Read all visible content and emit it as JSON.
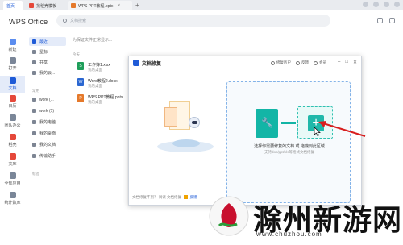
{
  "tabs": [
    {
      "label": "首页",
      "active": true
    },
    {
      "label": "找稻壳模板",
      "active": false
    },
    {
      "label": "WPS PPT教程.pptx",
      "active": false
    }
  ],
  "header": {
    "logo": "WPS Office",
    "search_placeholder": "文档搜索"
  },
  "rail": [
    {
      "label": "新建",
      "icon": "plus-icon",
      "color": "#5b8def"
    },
    {
      "label": "打开",
      "icon": "folder-icon",
      "color": "#7a8698"
    },
    {
      "label": "文档",
      "icon": "document-icon",
      "color": "#1f5bd7"
    },
    {
      "label": "日历",
      "icon": "calendar-icon",
      "color": "#e5483a"
    },
    {
      "label": "团队办公",
      "icon": "team-icon",
      "color": "#7a8698"
    },
    {
      "label": "稻壳",
      "icon": "docer-icon",
      "color": "#e5483a"
    },
    {
      "label": "文库",
      "icon": "library-icon",
      "color": "#e5483a"
    },
    {
      "label": "全部应用",
      "icon": "apps-icon",
      "color": "#7a8698"
    },
    {
      "label": "统计数库",
      "icon": "stats-icon",
      "color": "#7a8698"
    }
  ],
  "sidebar": {
    "items": [
      "最近",
      "星标",
      "共享",
      "我的云..."
    ],
    "section_label": "常用",
    "locations": [
      "work (...",
      "work (1)",
      "我的电脑",
      "我的桌面",
      "我的文档",
      "传输助手"
    ],
    "section2_label": "标签"
  },
  "main": {
    "hint": "为保证文件正常显示...",
    "list_header": "今天",
    "files": [
      {
        "name": "工作簿1.xlsx",
        "location": "我的桌面",
        "type": "xlsx",
        "color": "#1e9e5a",
        "glyph": "S"
      },
      {
        "name": "Word教程2.docx",
        "location": "我的桌面",
        "type": "docx",
        "color": "#2b67d1",
        "glyph": "W"
      },
      {
        "name": "WPS PPT教程.pptx",
        "location": "我的桌面",
        "type": "pptx",
        "color": "#e5792b",
        "glyph": "P"
      }
    ]
  },
  "dialog": {
    "title": "文档修复",
    "actions": [
      "修复历史",
      "反馈",
      "会员"
    ],
    "drop_text": "选择你需要修复的文档 或 拖拽到此区域",
    "drop_hint": "支持doc/ppt/xls等格式文档修复",
    "footer_text": "文档修复不到？ 试试 文档修复",
    "footer_link": "反馈"
  },
  "status": {
    "text": "● ● ●   ● ● ●"
  },
  "watermark": {
    "text": "滁州新游网",
    "url": "www.chuzhou.com"
  }
}
